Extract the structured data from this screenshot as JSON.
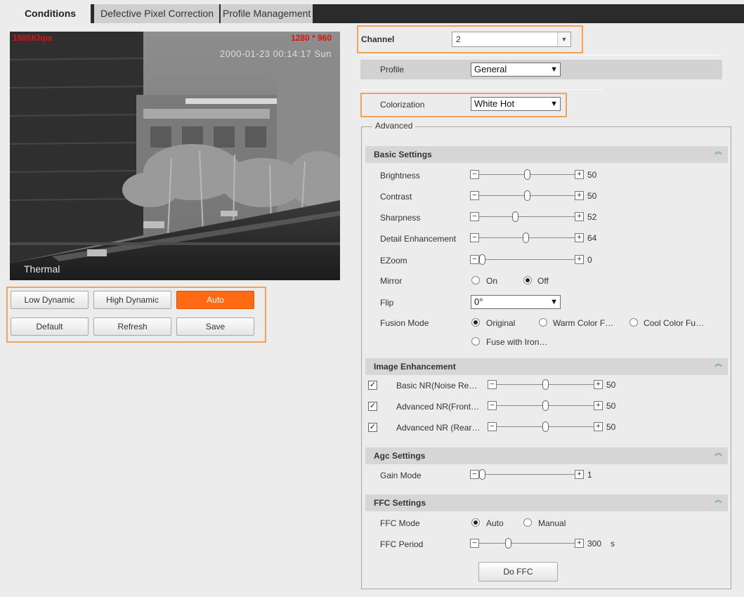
{
  "tabs": {
    "conditions": "Conditions",
    "defective": "Defective Pixel Correction",
    "profile": "Profile Management"
  },
  "video": {
    "bitrate": "1985Kbps",
    "resolution": "1280 * 960",
    "timestamp": "2000-01-23 00:14:17 Sun",
    "label": "Thermal"
  },
  "mode_buttons": {
    "low": "Low Dynamic",
    "high": "High Dynamic",
    "auto": "Auto"
  },
  "action_buttons": {
    "default": "Default",
    "refresh": "Refresh",
    "save": "Save"
  },
  "channel": {
    "label": "Channel",
    "value": "2"
  },
  "profile": {
    "label": "Profile",
    "value": "General"
  },
  "colorization": {
    "label": "Colorization",
    "value": "White Hot"
  },
  "advanced": "Advanced",
  "basic": {
    "title": "Basic Settings",
    "brightness": {
      "label": "Brightness",
      "value": "50",
      "level": 0.5
    },
    "contrast": {
      "label": "Contrast",
      "value": "50",
      "level": 0.5
    },
    "sharpness": {
      "label": "Sharpness",
      "value": "52",
      "level": 0.37
    },
    "detail": {
      "label": "Detail Enhancement",
      "value": "64",
      "level": 0.49
    },
    "ezoom": {
      "label": "EZoom",
      "value": "0",
      "level": 0.0
    },
    "mirror": {
      "label": "Mirror",
      "on": "On",
      "off": "Off"
    },
    "flip": {
      "label": "Flip",
      "value": "0°"
    },
    "fusion": {
      "label": "Fusion Mode",
      "original": "Original",
      "warm": "Warm Color F…",
      "cool": "Cool Color Fu…",
      "iron": "Fuse with Iron…"
    }
  },
  "enhance": {
    "title": "Image Enhancement",
    "basic_nr": {
      "label": "Basic NR(Noise Re…",
      "value": "50",
      "level": 0.5
    },
    "adv_front": {
      "label": "Advanced NR(Front…",
      "value": "50",
      "level": 0.5
    },
    "adv_rear": {
      "label": "Advanced NR (Rear…",
      "value": "50",
      "level": 0.5
    }
  },
  "agc": {
    "title": "Agc Settings",
    "gain": {
      "label": "Gain Mode",
      "value": "1",
      "level": 0.0
    }
  },
  "ffc": {
    "title": "FFC Settings",
    "mode": {
      "label": "FFC Mode",
      "auto": "Auto",
      "manual": "Manual"
    },
    "period": {
      "label": "FFC Period",
      "value": "300",
      "unit": "s",
      "level": 0.29
    },
    "do_button": "Do FFC"
  },
  "colors": {
    "accent": "#ff6a13",
    "highlight_border": "#f0a35c",
    "section_bar": "#d6d6d6",
    "collapse_icon": "#3a9e3a"
  }
}
